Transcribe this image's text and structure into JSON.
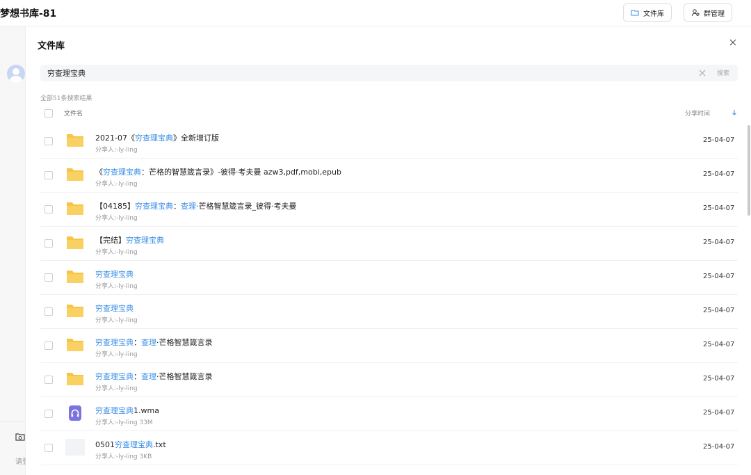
{
  "header": {
    "title": "梦想书库-81",
    "library_button": "文件库",
    "group_button": "群管理"
  },
  "sidebar": {
    "hint_text": "请登"
  },
  "panel": {
    "title": "文件库",
    "search": {
      "value": "穷查理宝典",
      "button": "搜索"
    },
    "result_count": "全部51条搜索结果",
    "columns": {
      "name": "文件名",
      "time": "分享时间"
    }
  },
  "files": [
    {
      "type": "folder",
      "parts": [
        {
          "t": "2021-07《"
        },
        {
          "t": "穷查理宝典",
          "hl": true
        },
        {
          "t": "》全新增订版"
        }
      ],
      "meta": "分享人:-ly-ling",
      "date": "25-04-07"
    },
    {
      "type": "folder",
      "parts": [
        {
          "t": "《"
        },
        {
          "t": "穷查理宝典",
          "hl": true
        },
        {
          "t": "：芒格的智慧箴言录》-彼得·考夫曼 azw3,pdf,mobi,epub"
        }
      ],
      "meta": "分享人:-ly-ling",
      "date": "25-04-07"
    },
    {
      "type": "folder",
      "parts": [
        {
          "t": "【04185】"
        },
        {
          "t": "穷查理宝典",
          "hl": true
        },
        {
          "t": "："
        },
        {
          "t": "查理",
          "hl": true
        },
        {
          "t": "·芒格智慧箴言录_彼得·考夫曼"
        }
      ],
      "meta": "分享人:-ly-ling",
      "date": "25-04-07"
    },
    {
      "type": "folder",
      "parts": [
        {
          "t": "【完结】"
        },
        {
          "t": "穷查理宝典",
          "hl": true
        }
      ],
      "meta": "分享人:-ly-ling",
      "date": "25-04-07"
    },
    {
      "type": "folder",
      "parts": [
        {
          "t": "穷查理宝典",
          "hl": true
        }
      ],
      "meta": "分享人:-ly-ling",
      "date": "25-04-07"
    },
    {
      "type": "folder",
      "parts": [
        {
          "t": "穷查理宝典",
          "hl": true
        }
      ],
      "meta": "分享人:-ly-ling",
      "date": "25-04-07"
    },
    {
      "type": "folder",
      "parts": [
        {
          "t": "穷查理宝典",
          "hl": true
        },
        {
          "t": "："
        },
        {
          "t": "查理",
          "hl": true
        },
        {
          "t": "·芒格智慧箴言录"
        }
      ],
      "meta": "分享人:-ly-ling",
      "date": "25-04-07"
    },
    {
      "type": "folder",
      "parts": [
        {
          "t": "穷查理宝典",
          "hl": true
        },
        {
          "t": "："
        },
        {
          "t": "查理",
          "hl": true
        },
        {
          "t": "·芒格智慧箴言录"
        }
      ],
      "meta": "分享人:-ly-ling",
      "date": "25-04-07"
    },
    {
      "type": "audio",
      "parts": [
        {
          "t": "穷查理宝典",
          "hl": true
        },
        {
          "t": "1.wma"
        }
      ],
      "meta": "分享人:-ly-ling 33M",
      "date": "25-04-07"
    },
    {
      "type": "text",
      "parts": [
        {
          "t": "0501"
        },
        {
          "t": "穷查理宝典",
          "hl": true
        },
        {
          "t": ".txt"
        }
      ],
      "meta": "分享人:-ly-ling 3KB",
      "date": "25-04-07"
    }
  ],
  "icons": {
    "folder_color": "#f6c544",
    "audio_color": "#7b73e0",
    "highlight_color": "#3a8ee6"
  }
}
